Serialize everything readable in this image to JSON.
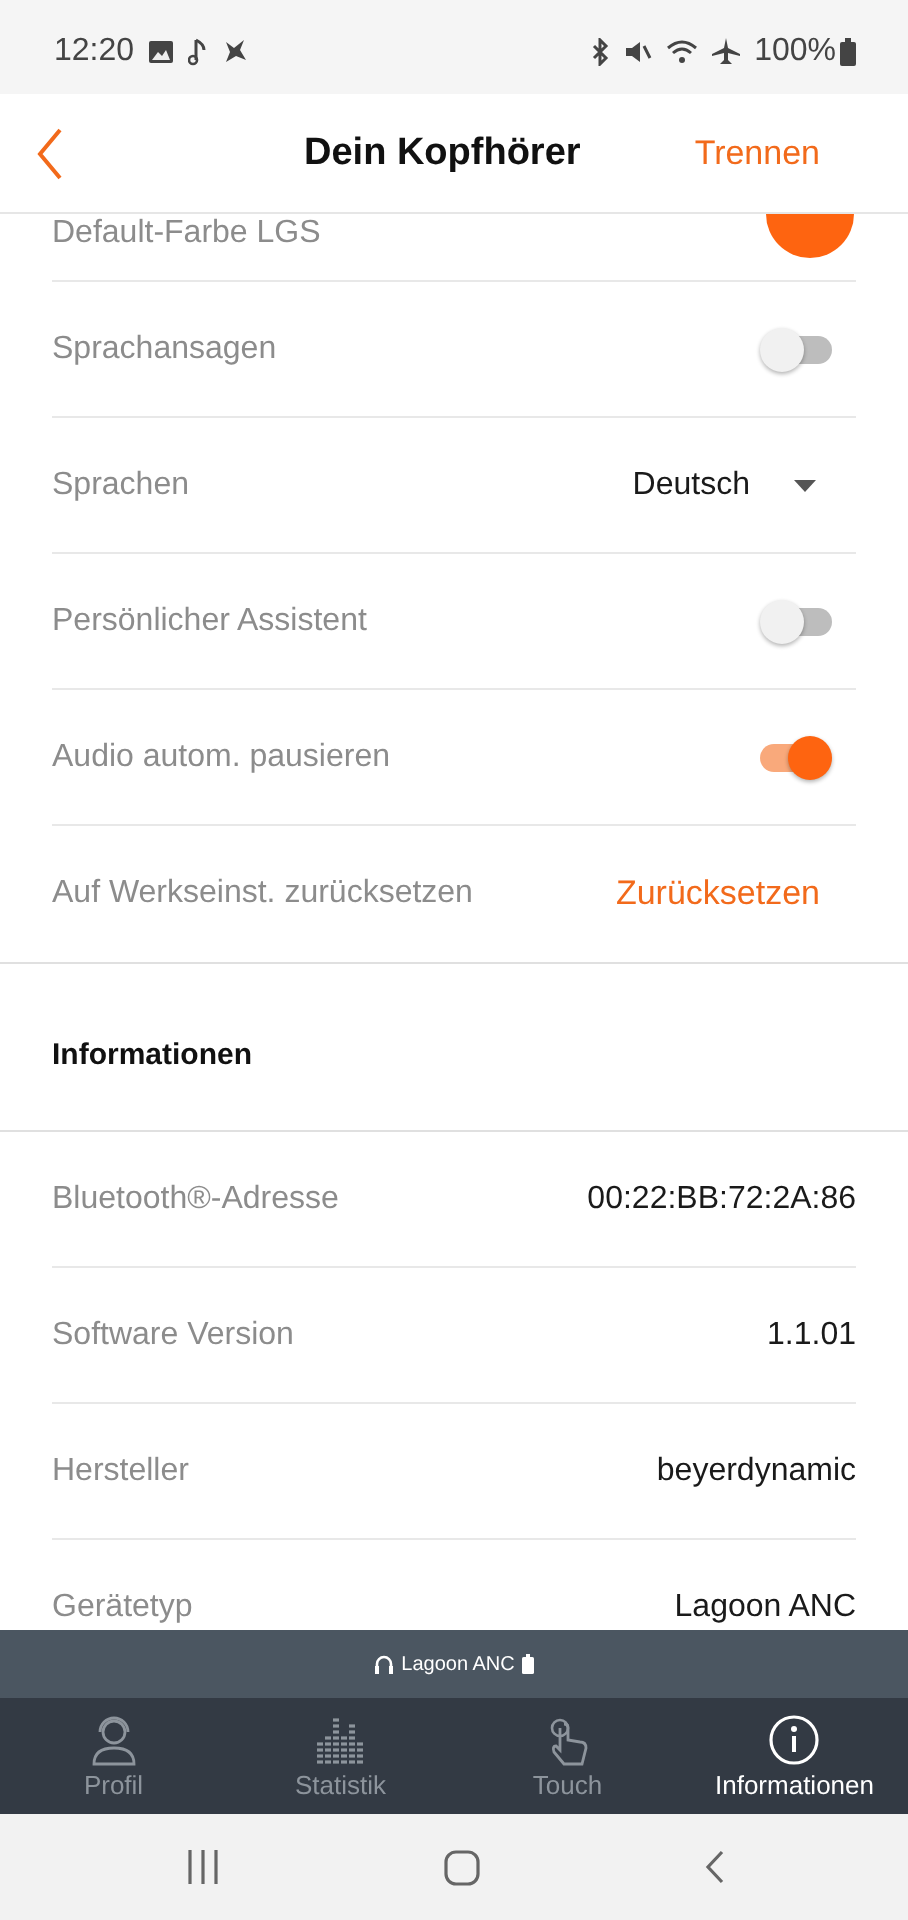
{
  "status_bar": {
    "time": "12:20",
    "battery": "100%"
  },
  "header": {
    "title": "Dein Kopfhörer",
    "action": "Trennen"
  },
  "settings": [
    {
      "kind": "color",
      "label": "Default-Farbe LGS",
      "color": "#fe6410"
    },
    {
      "kind": "toggle",
      "label": "Sprachansagen",
      "on": false
    },
    {
      "kind": "select",
      "label": "Sprachen",
      "value": "Deutsch"
    },
    {
      "kind": "toggle",
      "label": "Persönlicher Assistent",
      "on": false
    },
    {
      "kind": "toggle",
      "label": "Audio autom. pausieren",
      "on": true
    },
    {
      "kind": "action",
      "label": "Auf Werkseinst. zurücksetzen",
      "action": "Zurücksetzen"
    }
  ],
  "info": {
    "title": "Informationen",
    "rows": [
      {
        "label": "Bluetooth®-Adresse",
        "value": "00:22:BB:72:2A:86"
      },
      {
        "label": "Software Version",
        "value": "1.1.01"
      },
      {
        "label": "Hersteller",
        "value": "beyerdynamic"
      },
      {
        "label": "Gerätetyp",
        "value": "Lagoon ANC"
      }
    ]
  },
  "device_bar": {
    "name": "Lagoon ANC"
  },
  "tabs": [
    {
      "label": "Profil",
      "selected": false
    },
    {
      "label": "Statistik",
      "selected": false
    },
    {
      "label": "Touch",
      "selected": false
    },
    {
      "label": "Informationen",
      "selected": true
    }
  ]
}
